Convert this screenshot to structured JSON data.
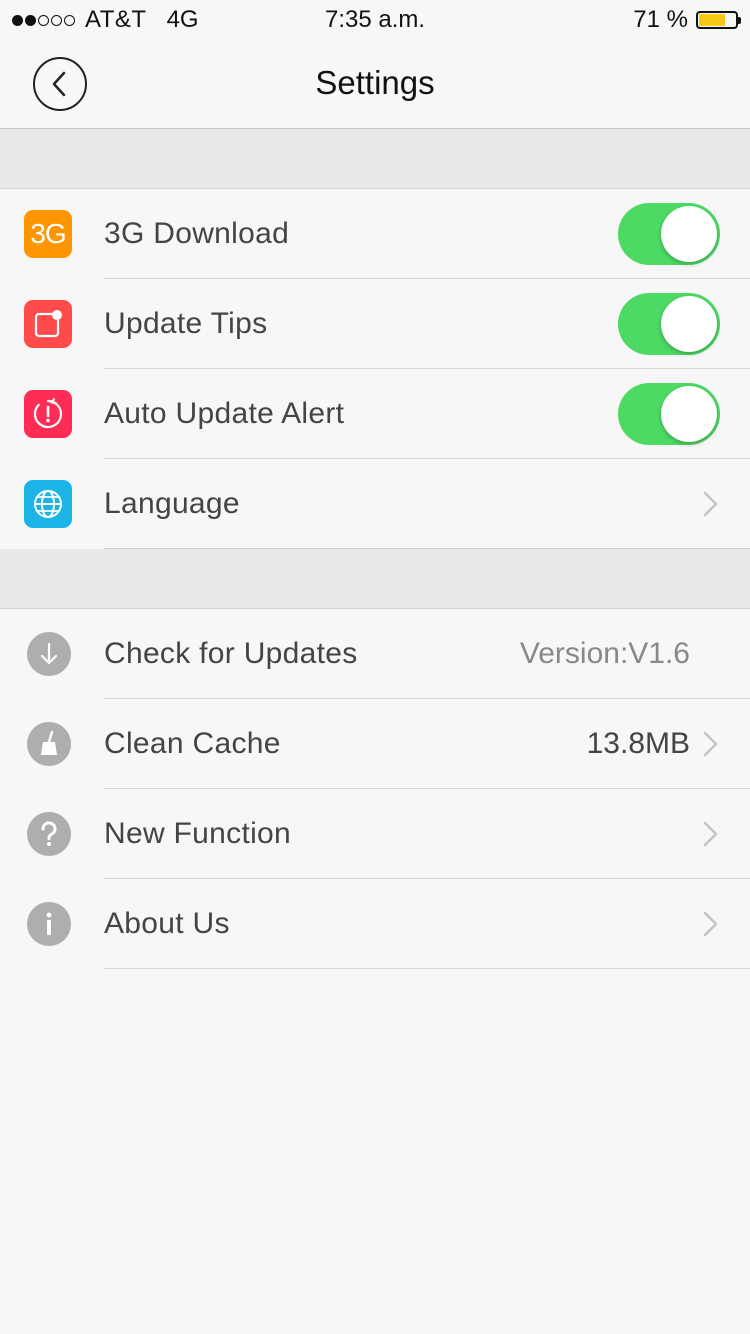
{
  "status_bar": {
    "carrier": "AT&T",
    "network": "4G",
    "time": "7:35 a.m.",
    "battery_percent": "71 %",
    "battery_level": 0.71,
    "signal_bars_filled": 2,
    "signal_bars_total": 5
  },
  "nav": {
    "title": "Settings",
    "back_icon": "chevron-left-icon"
  },
  "section1": [
    {
      "label": "3G Download",
      "icon": "3g-icon",
      "icon_text": "3G",
      "icon_color": "#ff9500",
      "toggle_on": true
    },
    {
      "label": "Update Tips",
      "icon": "update-tips-icon",
      "icon_color": "#ff4b4b",
      "toggle_on": true
    },
    {
      "label": "Auto Update Alert",
      "icon": "alarm-alert-icon",
      "icon_color": "#ff2d55",
      "toggle_on": true
    },
    {
      "label": "Language",
      "icon": "globe-icon",
      "icon_color": "#1ab4e6"
    }
  ],
  "section2": [
    {
      "label": "Check for Updates",
      "icon": "download-arrow-icon",
      "value": "Version:V1.6"
    },
    {
      "label": "Clean Cache",
      "icon": "broom-icon",
      "value": "13.8MB"
    },
    {
      "label": "New Function",
      "icon": "question-icon"
    },
    {
      "label": "About Us",
      "icon": "info-icon"
    }
  ],
  "colors": {
    "toggle_on": "#4cd964",
    "background": "#f7f7f7",
    "section_spacer": "#e9e9e9",
    "battery": "#f6c915"
  }
}
